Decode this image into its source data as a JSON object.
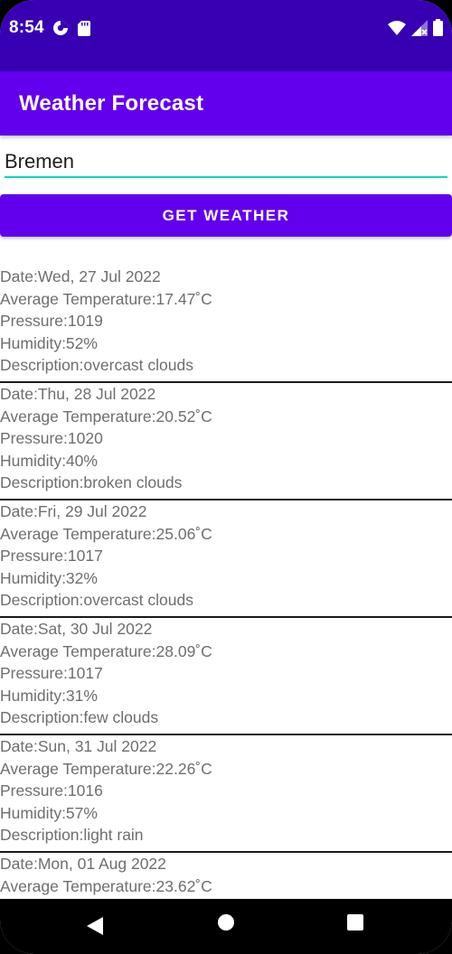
{
  "status_bar": {
    "time": "8:54",
    "left_icons": [
      "data-saver-icon",
      "sd-card-icon"
    ],
    "right_icons": [
      "wifi-icon",
      "signal-icon",
      "battery-icon"
    ]
  },
  "app_bar": {
    "title": "Weather Forecast"
  },
  "search": {
    "value": "Bremen"
  },
  "button": {
    "label": "GET WEATHER"
  },
  "forecast": [
    {
      "date": "Date:Wed, 27 Jul 2022",
      "temperature": "Average Temperature:17.47˚C",
      "pressure": "Pressure:1019",
      "humidity": "Humidity:52%",
      "description": "Description:overcast clouds"
    },
    {
      "date": "Date:Thu, 28 Jul 2022",
      "temperature": "Average Temperature:20.52˚C",
      "pressure": "Pressure:1020",
      "humidity": "Humidity:40%",
      "description": "Description:broken clouds"
    },
    {
      "date": "Date:Fri, 29 Jul 2022",
      "temperature": "Average Temperature:25.06˚C",
      "pressure": "Pressure:1017",
      "humidity": "Humidity:32%",
      "description": "Description:overcast clouds"
    },
    {
      "date": "Date:Sat, 30 Jul 2022",
      "temperature": "Average Temperature:28.09˚C",
      "pressure": "Pressure:1017",
      "humidity": "Humidity:31%",
      "description": "Description:few clouds"
    },
    {
      "date": "Date:Sun, 31 Jul 2022",
      "temperature": "Average Temperature:22.26˚C",
      "pressure": "Pressure:1016",
      "humidity": "Humidity:57%",
      "description": "Description:light rain"
    },
    {
      "date": "Date:Mon, 01 Aug 2022",
      "temperature": "Average Temperature:23.62˚C"
    }
  ],
  "nav_bar": {
    "icons": [
      "back-icon",
      "home-icon",
      "recents-icon"
    ]
  },
  "colors": {
    "status_bar": "#3700b3",
    "primary": "#6200ee",
    "accent": "#03dac5"
  }
}
